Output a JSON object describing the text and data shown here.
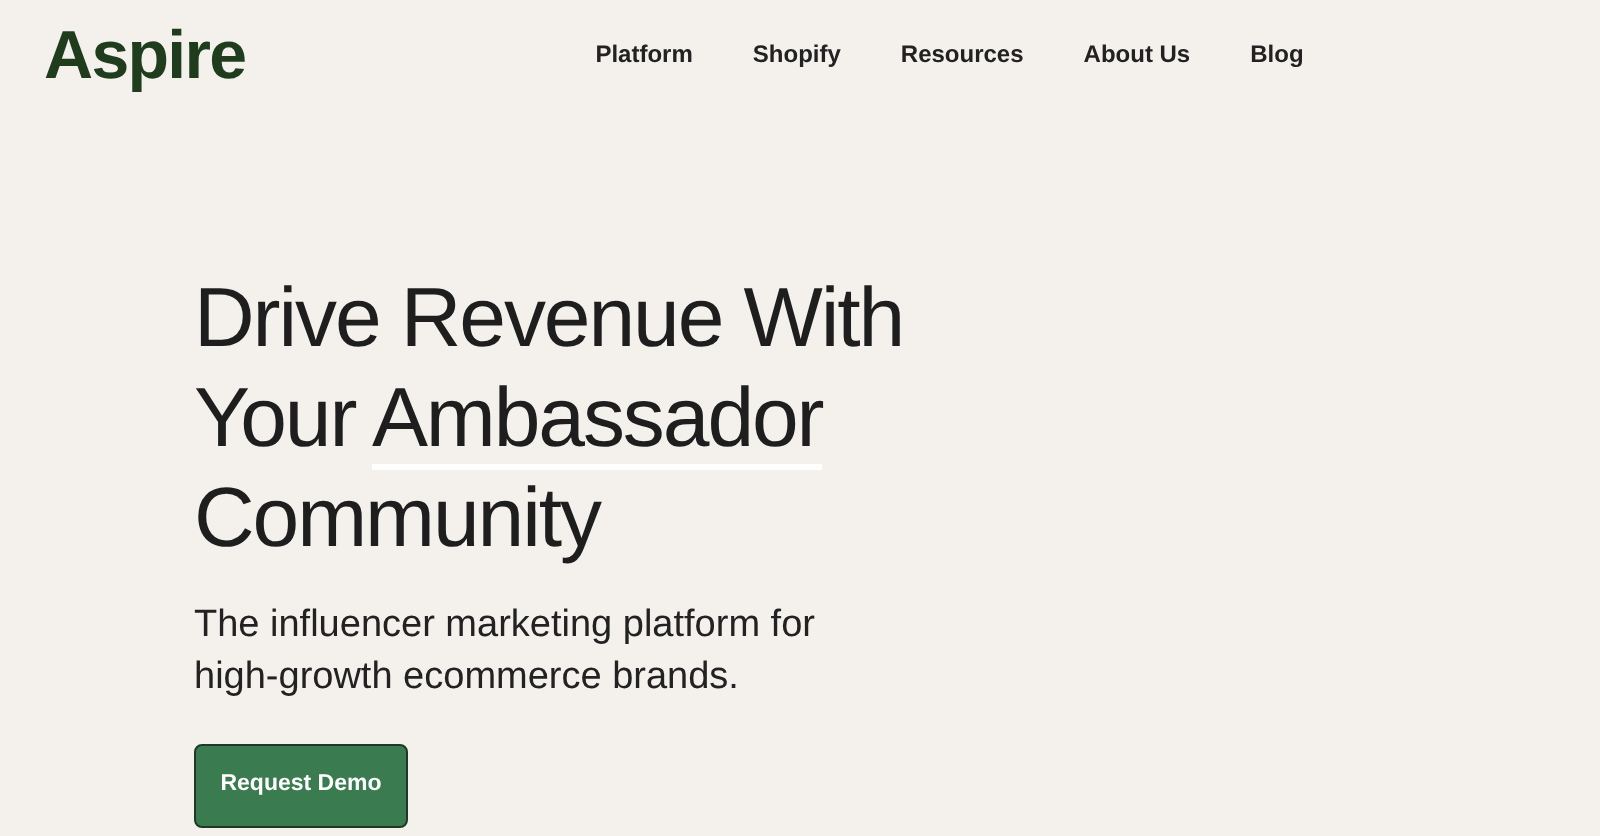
{
  "logo": "Aspire",
  "nav": [
    {
      "label": "Platform"
    },
    {
      "label": "Shopify"
    },
    {
      "label": "Resources"
    },
    {
      "label": "About Us"
    },
    {
      "label": "Blog"
    }
  ],
  "hero": {
    "heading_lines": [
      {
        "segments": [
          {
            "text": "Drive Revenue With",
            "underlined": false
          }
        ]
      },
      {
        "segments": [
          {
            "text": "Your ",
            "underlined": false
          },
          {
            "text": "Ambassador",
            "underlined": true
          }
        ]
      },
      {
        "segments": [
          {
            "text": "Community",
            "underlined": false
          }
        ]
      }
    ],
    "subtitle": "The influencer marketing platform for high-growth ecommerce brands.",
    "cta": "Request Demo"
  }
}
